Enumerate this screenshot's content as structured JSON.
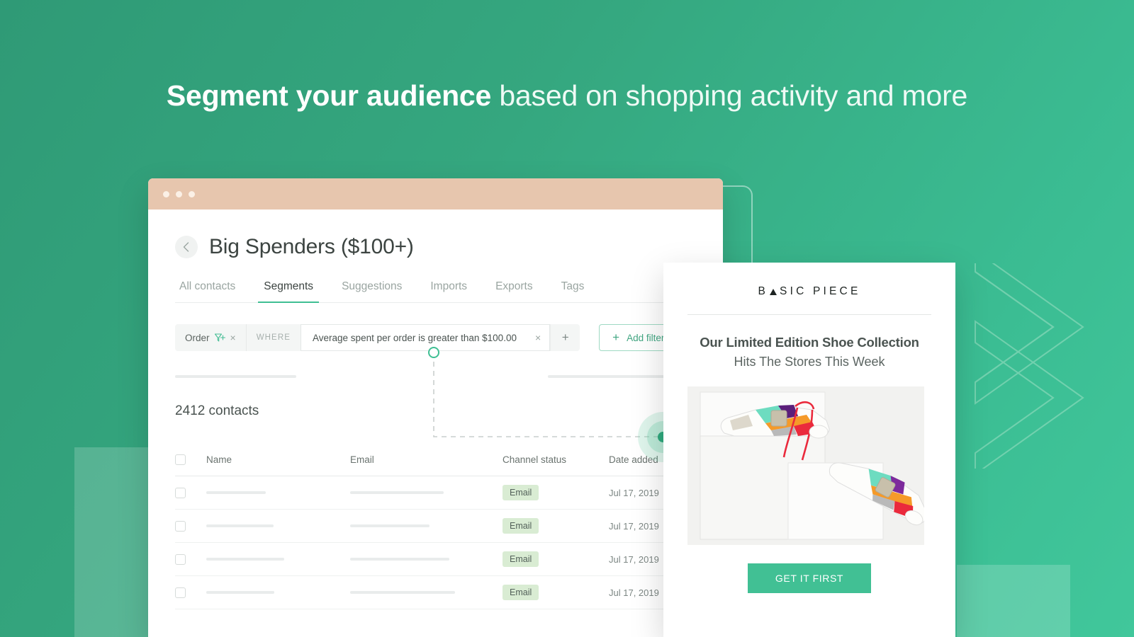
{
  "headline": {
    "strong": "Segment your audience",
    "light": " based on shopping activity and more"
  },
  "app_window": {
    "titlebar": {
      "dots": 3
    },
    "back_button_icon": "chevron-left-icon",
    "page_title": "Big Spenders ($100+)",
    "tabs": [
      {
        "label": "All contacts",
        "active": false
      },
      {
        "label": "Segments",
        "active": true
      },
      {
        "label": "Suggestions",
        "active": false
      },
      {
        "label": "Imports",
        "active": false
      },
      {
        "label": "Exports",
        "active": false
      },
      {
        "label": "Tags",
        "active": false
      }
    ],
    "filter_bar": {
      "entity_chip": "Order",
      "entity_icon": "filter-plus-icon",
      "entity_close": "×",
      "where_label": "WHERE",
      "condition_text": "Average spent per order is greater than $100.00",
      "condition_clear": "×",
      "condition_add": "+",
      "add_filter_label": "Add filter",
      "add_filter_plus": "+"
    },
    "contacts_count": "2412 contacts",
    "table": {
      "columns": [
        "Name",
        "Email",
        "Channel status",
        "Date added"
      ],
      "rows": [
        {
          "channel_status": "Email",
          "date_added": "Jul 17, 2019"
        },
        {
          "channel_status": "Email",
          "date_added": "Jul 17, 2019"
        },
        {
          "channel_status": "Email",
          "date_added": "Jul 17, 2019"
        },
        {
          "channel_status": "Email",
          "date_added": "Jul 17, 2019"
        }
      ]
    }
  },
  "email_card": {
    "brand_prefix": "B",
    "brand_suffix": "SIC PIECE",
    "headline": "Our Limited Edition Shoe Collection",
    "subheadline": "Hits The Stores This Week",
    "image_alt": "limited-edition-sneakers-on-white-box",
    "cta_label": "GET IT FIRST"
  },
  "colors": {
    "background_green": "#35a77f",
    "accent_green": "#3fbf93",
    "cta_green": "#41c094",
    "titlebar_peach": "#e7c6ae",
    "badge_green": "#d9ecd3"
  }
}
